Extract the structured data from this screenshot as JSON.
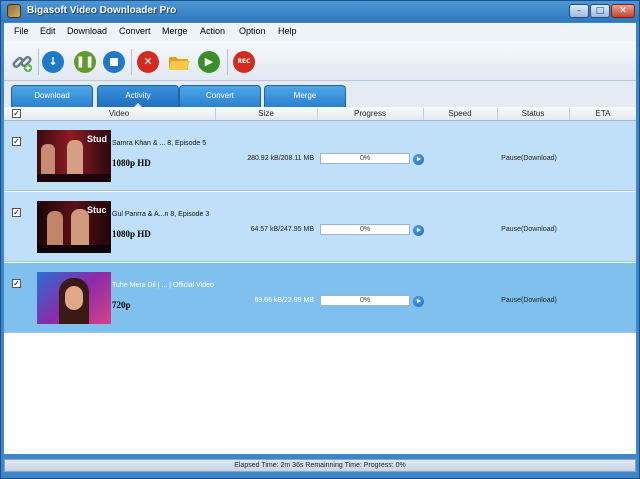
{
  "window": {
    "title": "Bigasoft Video Downloader Pro"
  },
  "menu": [
    "File",
    "Edit",
    "Download",
    "Convert",
    "Merge",
    "Action",
    "Option",
    "Help"
  ],
  "toolbar": {
    "buttons": [
      {
        "name": "add-url",
        "icon": "chain-link-icon",
        "color": "#7a8c99"
      },
      {
        "name": "download",
        "icon": "download-arrow-icon",
        "color": "#1e79c8"
      },
      {
        "name": "pause",
        "icon": "pause-icon",
        "color": "#5f9c2a"
      },
      {
        "name": "stop",
        "icon": "stop-icon",
        "color": "#1e79c8"
      },
      {
        "name": "delete",
        "icon": "x-icon",
        "color": "#d42a1f"
      },
      {
        "name": "open-folder",
        "icon": "folder-icon",
        "color": "#f0b429"
      },
      {
        "name": "play",
        "icon": "play-icon",
        "color": "#3a8f2a"
      },
      {
        "name": "record",
        "icon": "rec-icon",
        "color": "#d42a1f"
      }
    ],
    "rec_label": "REC"
  },
  "tabs": [
    "Download",
    "Activity",
    "Convert",
    "Merge"
  ],
  "columns": {
    "video": "Video",
    "size": "Size",
    "progress": "Progress",
    "speed": "Speed",
    "status": "Status",
    "eta": "ETA"
  },
  "rows": [
    {
      "checked": true,
      "title": "Samra Khan & ... 8, Episode 5",
      "resolution": "1080p HD",
      "size": "280.92 kB/208.11 MB",
      "progress": "0%",
      "progress_value": 0,
      "speed": "",
      "status": "Pause(Download)",
      "eta": "",
      "thumb_label": "Stud"
    },
    {
      "checked": true,
      "title": "Gul Panrra & A...n 8, Episode 3",
      "resolution": "1080p HD",
      "size": "64.57 kB/247.95 MB",
      "progress": "0%",
      "progress_value": 0,
      "speed": "",
      "status": "Pause(Download)",
      "eta": "",
      "thumb_label": "Stuc"
    },
    {
      "checked": true,
      "title": "Tuhe Mera Dil | ... | Official Video",
      "resolution": "720p",
      "size": "69.66 kB/22.99 MB",
      "progress": "0%",
      "progress_value": 0,
      "speed": "",
      "status": "Pause(Download)",
      "eta": "",
      "thumb_label": ""
    }
  ],
  "statusbar": "Elapsed Time: 2m 36s Remainning Time: Progress: 0%"
}
